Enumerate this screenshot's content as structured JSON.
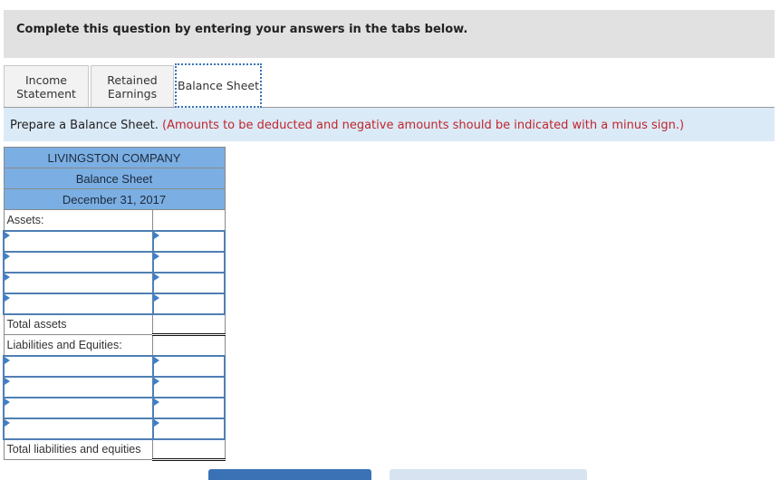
{
  "header": {
    "instruction": "Complete this question by entering your answers in the tabs below."
  },
  "tabs": [
    {
      "label": "Income Statement",
      "line1": "Income",
      "line2": "Statement",
      "active": false
    },
    {
      "label": "Retained Earnings",
      "line1": "Retained",
      "line2": "Earnings",
      "active": false
    },
    {
      "label": "Balance Sheet",
      "active": true
    }
  ],
  "instructions": {
    "prompt": "Prepare a Balance Sheet.",
    "note": "(Amounts to be deducted and negative amounts should be indicated with a minus sign.)"
  },
  "balance_sheet": {
    "company": "LIVINGSTON COMPANY",
    "title": "Balance Sheet",
    "date": "December 31, 2017",
    "assets_label": "Assets:",
    "asset_rows": [
      {
        "name": "",
        "amount": ""
      },
      {
        "name": "",
        "amount": ""
      },
      {
        "name": "",
        "amount": ""
      },
      {
        "name": "",
        "amount": ""
      }
    ],
    "total_assets_label": "Total assets",
    "total_assets_value": "",
    "liabilities_label": "Liabilities and Equities:",
    "liability_rows": [
      {
        "name": "",
        "amount": ""
      },
      {
        "name": "",
        "amount": ""
      },
      {
        "name": "",
        "amount": ""
      },
      {
        "name": "",
        "amount": ""
      }
    ],
    "total_liabilities_label": "Total liabilities and equities",
    "total_liabilities_value": ""
  },
  "colors": {
    "header_bg": "#e1e1e1",
    "instruction_bg": "#dbeaf7",
    "note_red": "#c0262d",
    "table_header_blue": "#7baee3",
    "input_border_blue": "#4f7fb4",
    "primary_button": "#3a72b5",
    "secondary_button": "#d7e3f1"
  }
}
